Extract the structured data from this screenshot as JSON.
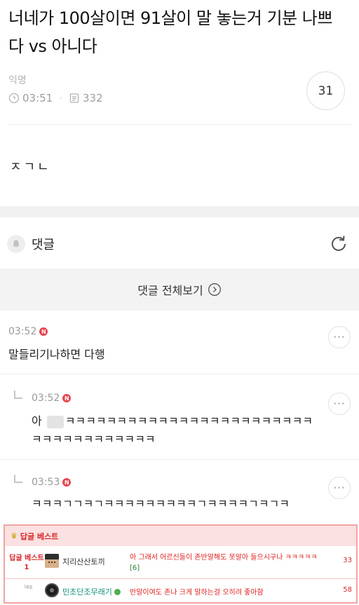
{
  "post": {
    "title": "너네가 100살이면 91살이 말 놓는거 기분 나쁘다 vs 아니다",
    "author": "익명",
    "time": "03:51",
    "views": "332",
    "comment_count": "31",
    "body": "ㅈㄱㄴ"
  },
  "comments_section": {
    "label": "댓글",
    "view_all_label": "댓글 전체보기"
  },
  "comments": [
    {
      "time": "03:52",
      "badge": "N",
      "text": "말들리기나하면 다행"
    },
    {
      "time": "03:52",
      "badge": "N",
      "text_prefix": "아 ",
      "text_rest": "ㅋㅋㅋㅋㅋㅋㅋㅋㅋㅋㅋㅋㅋㅋㅋㅋㅋㅋㅋㅋㅋㅋㅋㅋㅋㅋㅋㅋㅋㅋㅋㅋㅋㅋㅋㅋ"
    },
    {
      "time": "03:53",
      "badge": "N",
      "text": "ㅋㅋㅋㄱㄱㅋㄱㅋㅋㅋㅋㅋㅋㅋㅋㅋㄱㅋㅋㅋㅋㄱㅋㄱㅋ"
    }
  ],
  "best_replies": {
    "header": "답글 베스트",
    "rank_label": "답글 베스트1",
    "items": [
      {
        "nickname": "지리산산토끼",
        "text": "아 그래서 어르신들이 존반말해도 못알아 들으시구나 ㅋㅋㅋㅋㅋ",
        "bracket": "[6]",
        "count": "33"
      },
      {
        "re_label": "└RE",
        "nickname": "민초단조무래기",
        "text": "반말이여도 존나 크게 말하는걸 오히려 좋아함",
        "count": "58"
      }
    ]
  },
  "colors": {
    "badge_red": "#e8444f",
    "best_border": "#f2a3a3",
    "best_text": "#e02020",
    "nick_green": "#0e8f74"
  }
}
